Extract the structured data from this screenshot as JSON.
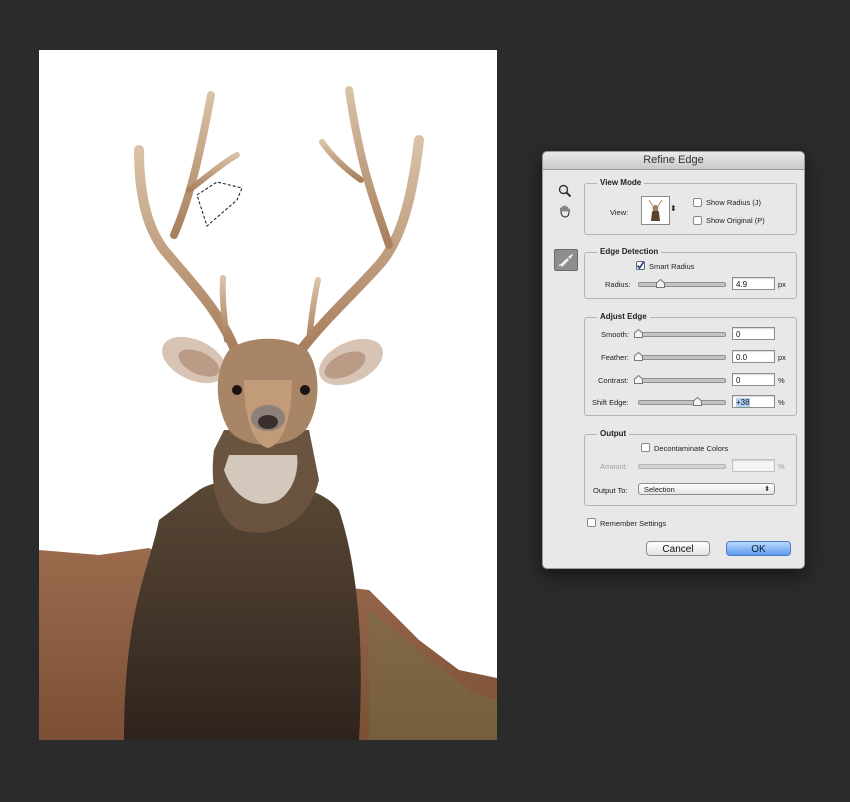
{
  "canvas": {
    "image_subject": "deer-photo"
  },
  "dialog": {
    "title": "Refine Edge",
    "view_mode": {
      "title": "View Mode",
      "view_label": "View:",
      "show_radius": "Show Radius (J)",
      "show_original": "Show Original (P)"
    },
    "edge_detection": {
      "title": "Edge Detection",
      "smart_radius": "Smart Radius",
      "smart_radius_checked": true,
      "radius_label": "Radius:",
      "radius_value": "4.9",
      "radius_unit": "px"
    },
    "adjust_edge": {
      "title": "Adjust Edge",
      "smooth_label": "Smooth:",
      "smooth_value": "0",
      "feather_label": "Feather:",
      "feather_value": "0.0",
      "feather_unit": "px",
      "contrast_label": "Contrast:",
      "contrast_value": "0",
      "contrast_unit": "%",
      "shift_label": "Shift Edge:",
      "shift_value": "+38",
      "shift_unit": "%"
    },
    "output": {
      "title": "Output",
      "decontaminate": "Decontaminate Colors",
      "amount_label": "Amount:",
      "amount_unit": "%",
      "output_to_label": "Output To:",
      "output_to_value": "Selection"
    },
    "remember": "Remember Settings",
    "cancel": "Cancel",
    "ok": "OK"
  }
}
